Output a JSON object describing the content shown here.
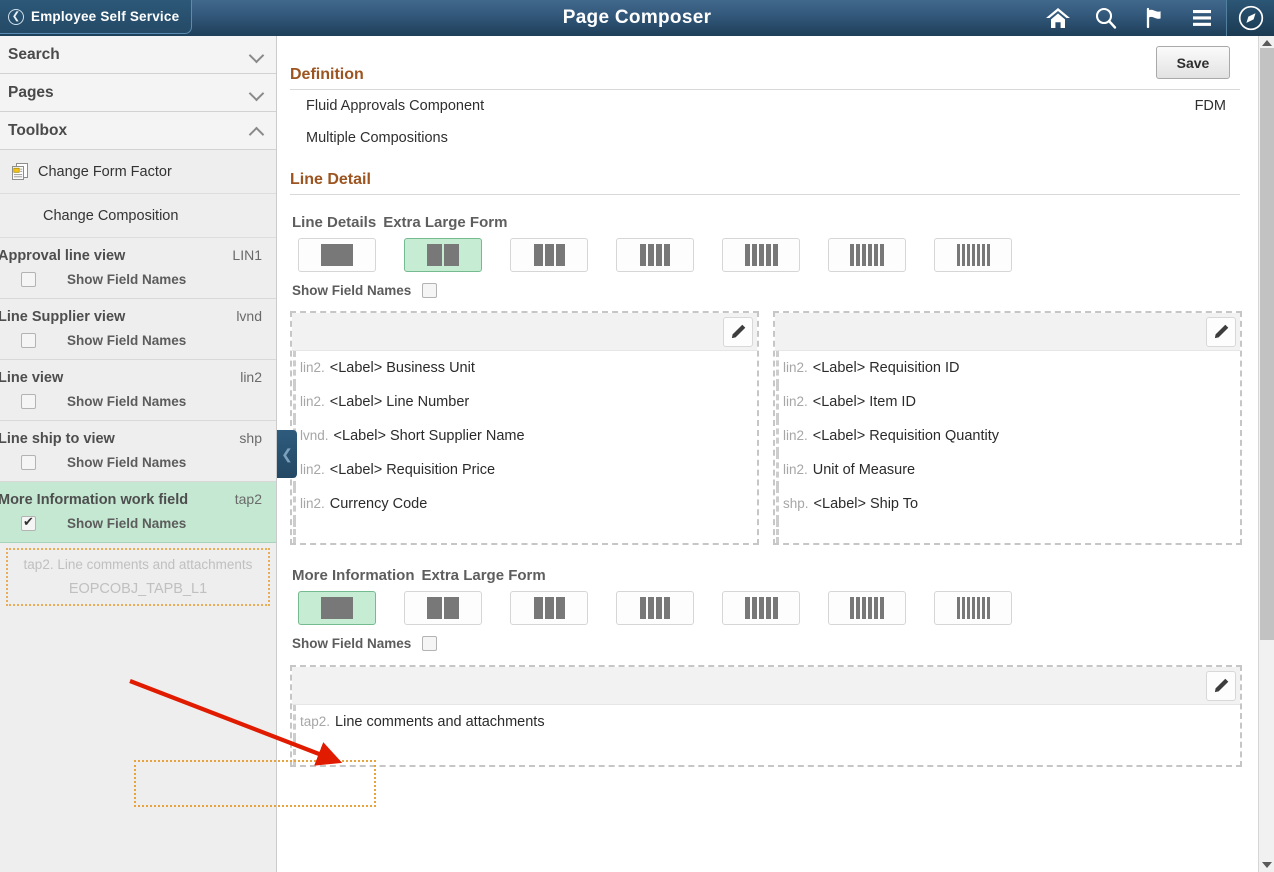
{
  "header": {
    "back_label": "Employee Self Service",
    "back_icon": "chevron-left-icon",
    "title": "Page Composer",
    "icons": [
      "home-icon",
      "search-icon",
      "flag-icon",
      "hamburger-menu-icon",
      "navbar-compass-icon"
    ]
  },
  "sidebar": {
    "panels": [
      {
        "title": "Search",
        "state": "collapsed",
        "caret": "chevron-down-icon"
      },
      {
        "title": "Pages",
        "state": "collapsed",
        "caret": "chevron-down-icon"
      },
      {
        "title": "Toolbox",
        "state": "expanded",
        "caret": "chevron-up-icon"
      }
    ],
    "tools": [
      {
        "label": "Change Form Factor",
        "icon": "form-factor-icon"
      },
      {
        "label": "Change Composition",
        "icon": ""
      }
    ],
    "views": [
      {
        "name": "Approval line view",
        "code": "LIN1",
        "checkbox_label": "Show Field Names",
        "checked": false,
        "selected": false
      },
      {
        "name": "Line Supplier view",
        "code": "lvnd",
        "checkbox_label": "Show Field Names",
        "checked": false,
        "selected": false
      },
      {
        "name": "Line view",
        "code": "lin2",
        "checkbox_label": "Show Field Names",
        "checked": false,
        "selected": false
      },
      {
        "name": "Line ship to view",
        "code": "shp",
        "checkbox_label": "Show Field Names",
        "checked": false,
        "selected": false
      },
      {
        "name": "More Information work field",
        "code": "tap2",
        "checkbox_label": "Show Field Names",
        "checked": true,
        "selected": true
      }
    ],
    "drag_ghost": {
      "line1": "tap2. Line comments and attachments",
      "line2": "EOPCOBJ_TAPB_L1"
    }
  },
  "content": {
    "save_label": "Save",
    "definition": {
      "section_title": "Definition",
      "rows": [
        {
          "label": "Fluid Approvals Component",
          "value": "FDM"
        },
        {
          "label": "Multiple Compositions",
          "value": ""
        }
      ]
    },
    "line_detail": {
      "section_title": "Line Detail",
      "form_name": "Line Details",
      "form_size": "Extra Large Form",
      "selected_columns": 2,
      "show_field_names_label": "Show Field Names",
      "show_field_names_checked": false,
      "trash_icon": "trash-icon",
      "edit_icon": "pencil-icon",
      "columns": [
        {
          "fields": [
            {
              "prefix": "lin2.",
              "label": "<Label> Business Unit"
            },
            {
              "prefix": "lin2.",
              "label": "<Label> Line Number"
            },
            {
              "prefix": "lvnd.",
              "label": "<Label> Short Supplier Name"
            },
            {
              "prefix": "lin2.",
              "label": "<Label> Requisition Price"
            },
            {
              "prefix": "lin2.",
              "label": "Currency Code"
            }
          ]
        },
        {
          "fields": [
            {
              "prefix": "lin2.",
              "label": "<Label> Requisition ID"
            },
            {
              "prefix": "lin2.",
              "label": "<Label> Item ID"
            },
            {
              "prefix": "lin2.",
              "label": "<Label> Requisition Quantity"
            },
            {
              "prefix": "lin2.",
              "label": "Unit of Measure"
            },
            {
              "prefix": "shp.",
              "label": "<Label> Ship To"
            }
          ]
        }
      ]
    },
    "more_information": {
      "form_name": "More Information",
      "form_size": "Extra Large Form",
      "selected_columns": 1,
      "show_field_names_label": "Show Field Names",
      "show_field_names_checked": false,
      "trash_icon": "trash-icon",
      "edit_icon": "pencil-icon",
      "columns": [
        {
          "fields": [
            {
              "prefix": "tap2.",
              "label": "Line comments and attachments"
            }
          ]
        }
      ]
    }
  },
  "colors": {
    "header_top": "#41698c",
    "header_bottom": "#1f3f59",
    "section_title": "#9c5420",
    "selected_green_bg": "#c6ecd4",
    "selected_green_border": "#76bb90",
    "sidebar_selected_bg": "#c4e8d2",
    "drag_outline": "#e8a33d",
    "annotation_arrow": "#e01b00"
  }
}
